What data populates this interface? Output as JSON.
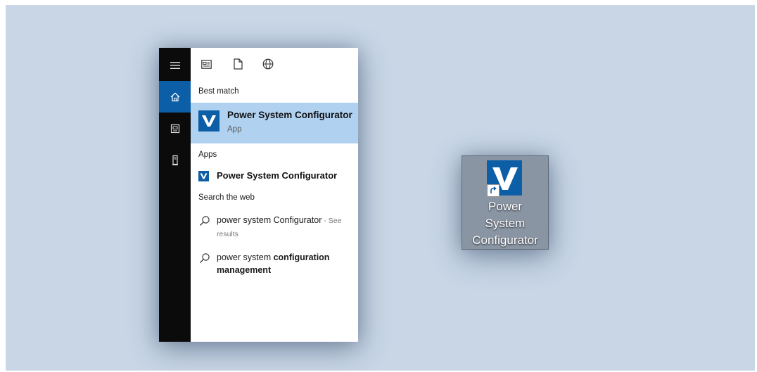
{
  "start_menu": {
    "rail": {
      "items": [
        {
          "icon": "hamburger-menu-icon"
        },
        {
          "icon": "home-icon"
        },
        {
          "icon": "documents-icon"
        },
        {
          "icon": "tower-icon"
        }
      ],
      "active_color": "#0c5ea6",
      "background_color": "#0b0b0b"
    },
    "top_filters": [
      {
        "icon": "apps-filter-icon"
      },
      {
        "icon": "document-filter-icon"
      },
      {
        "icon": "web-globe-icon"
      }
    ],
    "best_match": {
      "header": "Best match",
      "title": "Power System Configurator",
      "subtitle": "App",
      "highlight_color": "#b0d1f0"
    },
    "apps": {
      "header": "Apps",
      "items": [
        {
          "title": "Power System Configurator"
        }
      ]
    },
    "web": {
      "header": "Search the web",
      "results": [
        {
          "query": "power system Configurator",
          "suffix": " - See",
          "suffix2": "results"
        },
        {
          "query_plain": "power system ",
          "query_bold": "configuration",
          "query_bold2": "management"
        }
      ]
    }
  },
  "desktop_icon": {
    "label_line1": "Power",
    "label_line2": "System",
    "label_line3": "Configurator",
    "brand_color": "#0c5ea6"
  },
  "background_color": "#c8d6e6"
}
